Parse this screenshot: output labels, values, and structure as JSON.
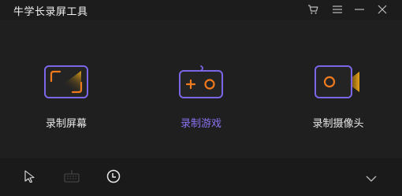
{
  "window": {
    "title": "牛学长录屏工具",
    "controls": {
      "cart_icon": "cart-icon",
      "menu_icon": "menu-icon",
      "minimize_icon": "minimize-icon",
      "close_icon": "close-icon"
    }
  },
  "modes": [
    {
      "label": "录制屏幕",
      "icon": "screen-record-icon",
      "active": false
    },
    {
      "label": "录制游戏",
      "icon": "gamepad-icon",
      "active": true
    },
    {
      "label": "录制摄像头",
      "icon": "camera-icon",
      "active": false
    }
  ],
  "footer": {
    "pointer_icon": "mouse-pointer-icon",
    "keyboard_icon": "keyboard-icon",
    "clock_icon": "schedule-clock-icon",
    "expand_icon": "chevron-down-icon"
  },
  "colors": {
    "background": "#1f1f1f",
    "titlebar": "#1c1c1c",
    "footer": "#1a1a1a",
    "accent_purple": "#7b66e8",
    "accent_orange": "#f07a1e",
    "accent_gold": "#e8a317",
    "active_label": "#8b72f2",
    "text": "#e8e8e8"
  }
}
